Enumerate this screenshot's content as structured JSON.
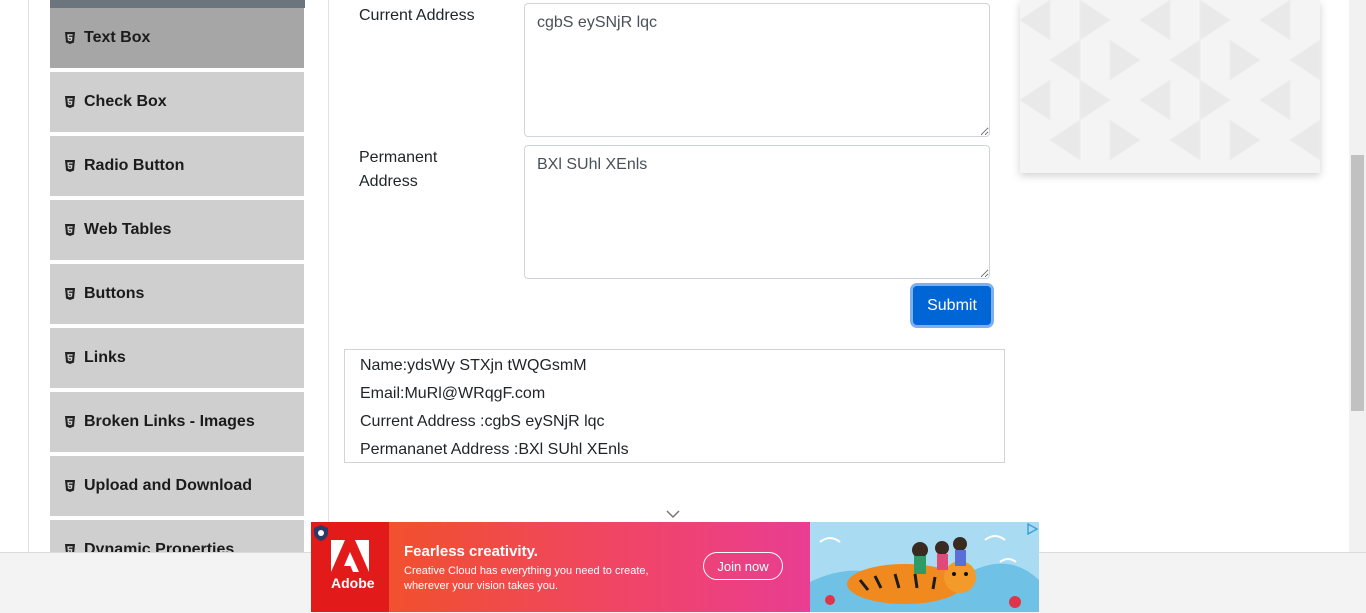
{
  "sidebar": {
    "items": [
      {
        "label": "Text Box",
        "active": true
      },
      {
        "label": "Check Box"
      },
      {
        "label": "Radio Button"
      },
      {
        "label": "Web Tables"
      },
      {
        "label": "Buttons"
      },
      {
        "label": "Links"
      },
      {
        "label": "Broken Links - Images"
      },
      {
        "label": "Upload and Download"
      },
      {
        "label": "Dynamic Properties"
      }
    ]
  },
  "form": {
    "current_address_label": "Current Address",
    "current_address_value": "cgbS eySNjR lqc",
    "permanent_address_label_line1": "Permanent",
    "permanent_address_label_line2": "Address",
    "permanent_address_value": "BXl SUhl XEnls",
    "submit_label": "Submit"
  },
  "output": {
    "name": "Name:ydsWy STXjn tWQGsmM",
    "email": "Email:MuRl@WRqgF.com",
    "current_address": "Current Address :cgbS eySNjR lqc",
    "permanent_address": "Permananet Address :BXl SUhl XEnls"
  },
  "ad": {
    "brand": "Adobe",
    "headline": "Fearless creativity.",
    "subtext": "Creative Cloud has everything you need to create, wherever your vision takes you.",
    "cta": "Join now"
  },
  "colors": {
    "submit": "#0066d6",
    "sidebar_item": "#cfcfcf",
    "sidebar_active": "#a6a6a6"
  }
}
